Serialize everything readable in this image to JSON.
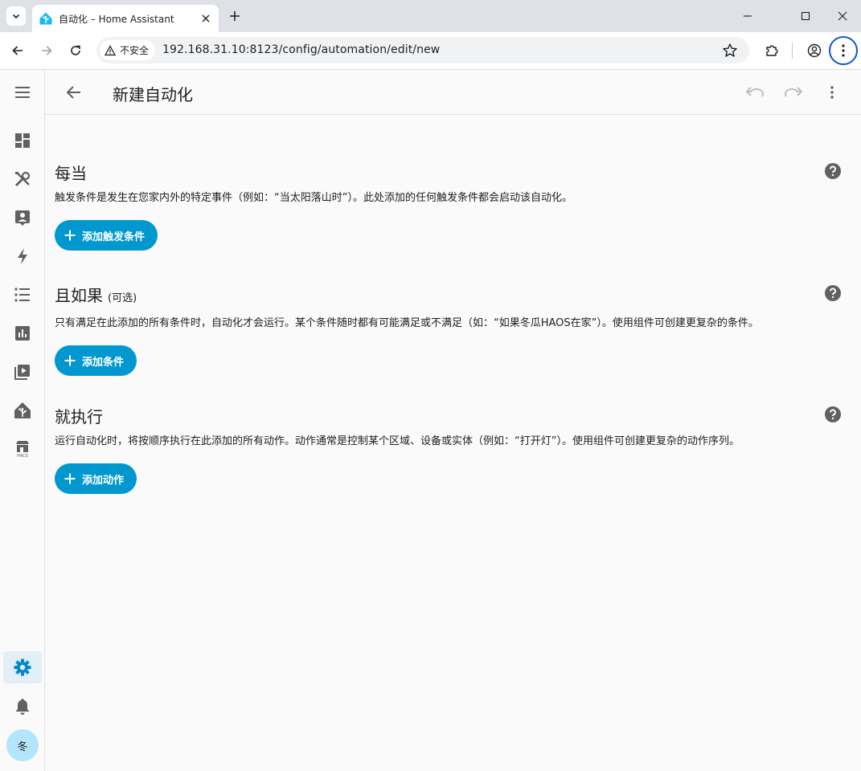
{
  "browser": {
    "tab_title": "自动化 – Home Assistant",
    "security_label": "不安全",
    "url": "192.168.31.10:8123/config/automation/edit/new"
  },
  "header": {
    "title": "新建自动化"
  },
  "sidebar": {
    "items": [
      "dashboard-icon",
      "tools-icon",
      "account-box-icon",
      "lightning-icon",
      "list-icon",
      "chart-icon",
      "media-icon",
      "home-assistant-icon",
      "hacs-icon"
    ],
    "hacs_label": "HACS",
    "avatar_initial": "冬"
  },
  "sections": {
    "triggers": {
      "title": "每当",
      "description": "触发条件是发生在您家内外的特定事件（例如：“当太阳落山时”）。此处添加的任何触发条件都会启动该自动化。",
      "button_label": "添加触发条件"
    },
    "conditions": {
      "title": "且如果",
      "optional": "(可选)",
      "description": "只有满足在此添加的所有条件时，自动化才会运行。某个条件随时都有可能满足或不满足（如：“如果冬瓜HAOS在家”）。使用组件可创建更复杂的条件。",
      "button_label": "添加条件"
    },
    "actions": {
      "title": "就执行",
      "description": "运行自动化时，将按顺序执行在此添加的所有动作。动作通常是控制某个区域、设备或实体（例如：“打开灯”）。使用组件可创建更复杂的动作序列。",
      "button_label": "添加动作"
    }
  },
  "colors": {
    "primary": "#0098cf",
    "icon": "#616161",
    "active_icon": "#0288d1"
  }
}
